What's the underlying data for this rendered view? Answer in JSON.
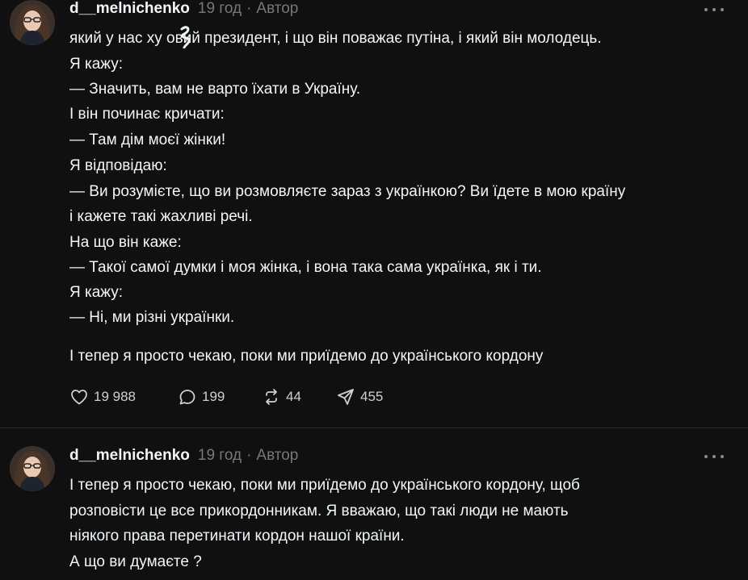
{
  "posts": [
    {
      "username": "d__melnichenko",
      "time": "19 год",
      "separator": "·",
      "role": "Автор",
      "lines": [
        "який у нас ху  овий президент, і що він поважає путіна, і який він молодець.",
        "Я кажу:",
        "— Значить, вам не варто їхати в Україну.",
        "І він починає кричати:",
        "— Там дім моєї жінки!",
        "Я відповідаю:",
        "— Ви розумієте, що ви розмовляєте зараз з українкою? Ви їдете в мою країну",
        "і кажете такі жахливі речі.",
        "На що він каже:",
        "— Такої самої думки і моя жінка, і вона така сама українка, як і ти.",
        "Я кажу:",
        "— Ні, ми різні українки.",
        "І тепер я просто чекаю, поки ми приїдемо до українського кордону"
      ],
      "likes": "19 988",
      "comments": "199",
      "reposts": "44",
      "shares": "455",
      "icons": {
        "like": "heart-icon",
        "comment": "comment-icon",
        "repost": "repost-icon",
        "share": "send-icon",
        "more": "more-icon"
      }
    },
    {
      "username": "d__melnichenko",
      "time": "19 год",
      "separator": "·",
      "role": "Автор",
      "lines": [
        "І тепер я просто чекаю, поки ми приїдемо до українського кордону, щоб",
        "розповісти це все прикордонникам. Я вважаю, що такі люди не мають",
        "ніякого права перетинати кордон нашої країни.",
        "А що ви думаєте ?"
      ]
    }
  ],
  "colors": {
    "background": "#101010",
    "text": "#f3f5f7",
    "muted": "#777777",
    "divider": "#2d2d2d"
  }
}
